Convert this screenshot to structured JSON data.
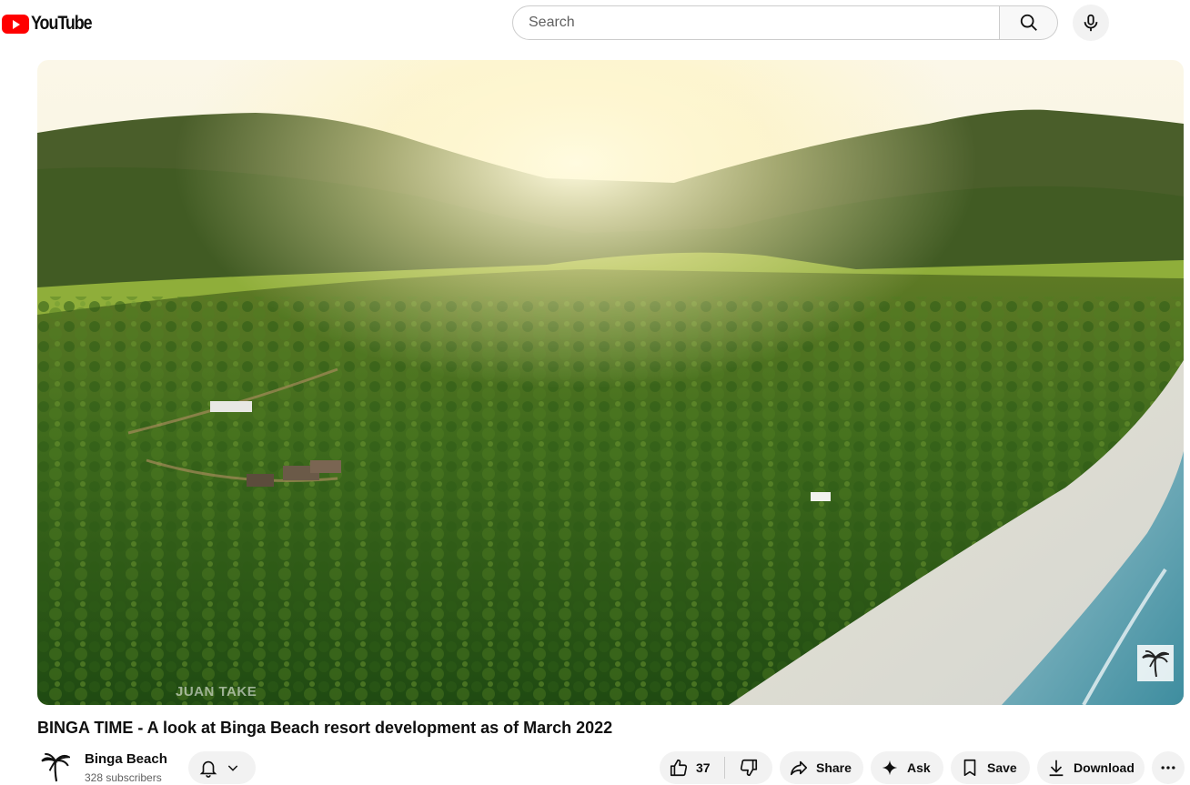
{
  "header": {
    "logo_text": "YouTube",
    "search_placeholder": "Search"
  },
  "player": {
    "watermark": "JUAN TAKE"
  },
  "video": {
    "title": "BINGA TIME - A look at Binga Beach resort development as of March 2022",
    "channel_name": "Binga Beach",
    "subscribers": "328 subscribers",
    "likes": "37"
  },
  "actions": {
    "share": "Share",
    "ask": "Ask",
    "save": "Save",
    "download": "Download"
  }
}
